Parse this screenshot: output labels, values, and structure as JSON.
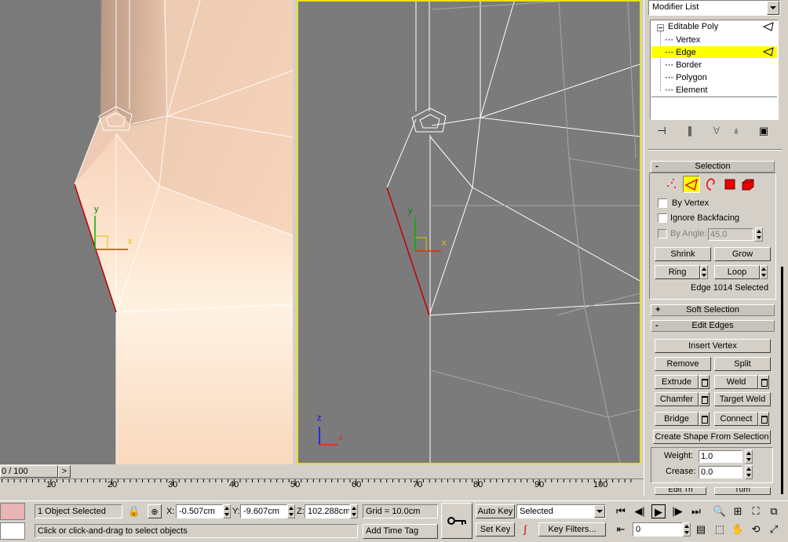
{
  "viewport_left": {
    "axis_y": "y",
    "axis_x": "x"
  },
  "viewport_right": {
    "axis_y": "y",
    "axis_x": "x",
    "corner_z": "z",
    "corner_x": "x"
  },
  "modifier_list": {
    "label": "Modifier List"
  },
  "stack": {
    "items": [
      {
        "label": "Editable Poly"
      },
      {
        "label": "Vertex"
      },
      {
        "label": "Edge"
      },
      {
        "label": "Border"
      },
      {
        "label": "Polygon"
      },
      {
        "label": "Element"
      }
    ],
    "selected": "Edge"
  },
  "selection_rollout": {
    "title": "Selection",
    "sign": "-",
    "by_vertex": "By Vertex",
    "ignore_backfacing": "Ignore Backfacing",
    "by_angle": "By Angle:",
    "angle_value": "45.0",
    "shrink": "Shrink",
    "grow": "Grow",
    "ring": "Ring",
    "loop": "Loop",
    "status": "Edge 1014 Selected"
  },
  "soft_selection": {
    "title": "Soft Selection",
    "sign": "+"
  },
  "edit_edges": {
    "title": "Edit Edges",
    "sign": "-",
    "insert_vertex": "Insert Vertex",
    "remove": "Remove",
    "split": "Split",
    "extrude": "Extrude",
    "weld": "Weld",
    "chamfer": "Chamfer",
    "target_weld": "Target Weld",
    "bridge": "Bridge",
    "connect": "Connect",
    "create_shape": "Create Shape From Selection",
    "weight_label": "Weight:",
    "weight_value": "1.0",
    "crease_label": "Crease:",
    "crease_value": "0.0",
    "edit_tri": "Edit Tri",
    "turn": "Turn"
  },
  "timeline": {
    "frame": "0 / 100",
    "next": ">"
  },
  "ruler": {
    "labels": [
      "10",
      "20",
      "30",
      "40",
      "50",
      "60",
      "70",
      "80",
      "90",
      "100"
    ]
  },
  "status": {
    "objects": "1 Object Selected",
    "x_label": "X:",
    "x_value": "-0.507cm",
    "y_label": "Y:",
    "y_value": "-9.607cm",
    "z_label": "Z:",
    "z_value": "102.288cm",
    "grid": "Grid = 10.0cm",
    "prompt": "Click or click-and-drag to select objects",
    "add_time_tag": "Add Time Tag",
    "auto_key": "Auto Key",
    "set_key": "Set Key",
    "selected_dropdown": "Selected",
    "key_filters": "Key Filters...",
    "frame_value": "0"
  },
  "colors": {
    "active_viewport_border": "#e8e020",
    "selected_stack_item": "#ffff00",
    "selected_edge": "#c00000"
  }
}
